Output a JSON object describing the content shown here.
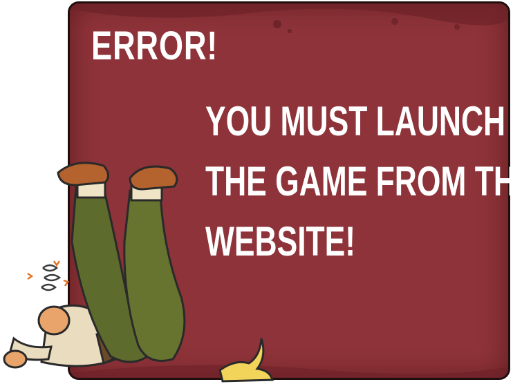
{
  "dialog": {
    "title": "ERROR!",
    "message_lines": [
      "YOU MUST LAUNCH",
      "THE GAME FROM THE",
      "WEBSITE!"
    ]
  },
  "icons": {
    "character": "fallen-explorer-icon",
    "peel": "banana-peel-icon",
    "dizzy": "dizzy-swirl-icon"
  },
  "colors": {
    "panel": "#8e3339",
    "border": "#1e0e0e",
    "text": "#ffffff"
  }
}
